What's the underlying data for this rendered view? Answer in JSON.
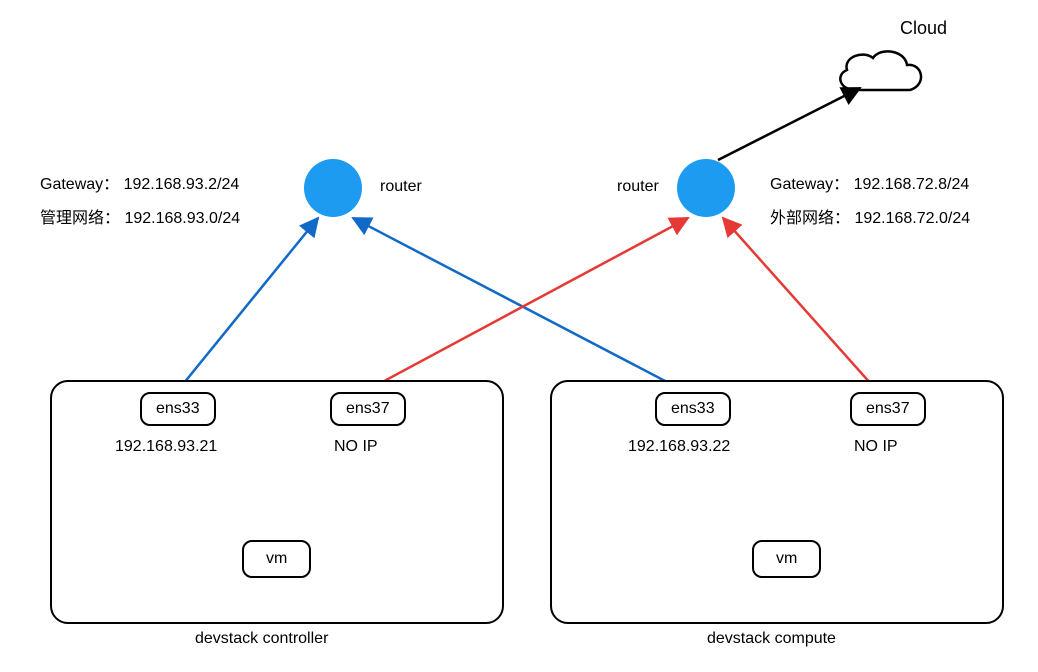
{
  "cloud": {
    "label": "Cloud"
  },
  "routers": {
    "left": {
      "label": "router"
    },
    "right": {
      "label": "router"
    }
  },
  "leftInfo": {
    "gatewayLabel": "Gateway：",
    "gatewayValue": "192.168.93.2/24",
    "netLabel": "管理网络：",
    "netValue": "192.168.93.0/24"
  },
  "rightInfo": {
    "gatewayLabel": "Gateway：",
    "gatewayValue": "192.168.72.8/24",
    "netLabel": "外部网络：",
    "netValue": "192.168.72.0/24"
  },
  "controller": {
    "title": "devstack controller",
    "ens33": {
      "name": "ens33",
      "ip": "192.168.93.21"
    },
    "ens37": {
      "name": "ens37",
      "ip": "NO IP"
    },
    "vm": {
      "name": "vm"
    }
  },
  "compute": {
    "title": "devstack compute",
    "ens33": {
      "name": "ens33",
      "ip": "192.168.93.22"
    },
    "ens37": {
      "name": "ens37",
      "ip": "NO IP"
    },
    "vm": {
      "name": "vm"
    }
  },
  "colors": {
    "blue": "#1169c8",
    "red": "#e53935",
    "black": "#000000",
    "routerFill": "#1d9bf0"
  }
}
